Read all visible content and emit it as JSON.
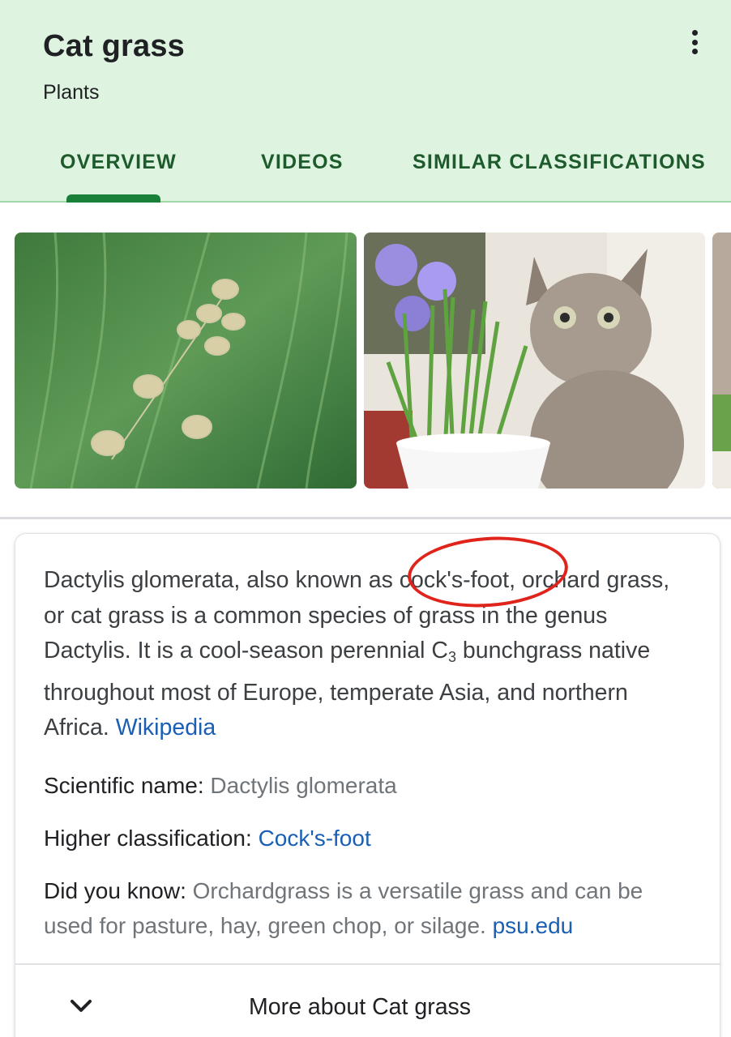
{
  "header": {
    "title": "Cat grass",
    "subtitle": "Plants",
    "menu_icon": "more-vert-icon",
    "tabs": [
      {
        "label": "OVERVIEW",
        "active": true
      },
      {
        "label": "VIDEOS",
        "active": false
      },
      {
        "label": "SIMILAR CLASSIFICATIONS",
        "active": false
      }
    ]
  },
  "images": [
    {
      "subject": "cocks-foot-grass-flower-photo"
    },
    {
      "subject": "cat-with-potted-grass-photo"
    },
    {
      "subject": "cat-partial-photo"
    }
  ],
  "description": {
    "pre": "Dactylis glomerata, also known as ",
    "highlight": "cock's-foot",
    "post": ", orchard grass, or cat grass is a common species of grass in the genus Dactylis. It is a cool-season perennial C",
    "subscript": "3",
    "post2": " bunchgrass native throughout most of Europe, temperate Asia, and northern Africa. ",
    "source": "Wikipedia"
  },
  "facts": {
    "scientific_name": {
      "label": "Scientific name: ",
      "value": "Dactylis glomerata"
    },
    "higher_classification": {
      "label": "Higher classification: ",
      "value": "Cock's-foot"
    },
    "did_you_know": {
      "label": "Did you know: ",
      "value": "Orchardgrass is a versatile grass and can be used for pasture, hay, green chop, or silage. ",
      "source": "psu.edu"
    }
  },
  "more": {
    "label": "More about Cat grass",
    "icon": "chevron-down-icon"
  },
  "colors": {
    "header_bg": "#def4e0",
    "tab_text": "#1e5b2c",
    "tab_indicator": "#188038",
    "link": "#1a5fb4",
    "annotation_circle": "#e0241b"
  }
}
